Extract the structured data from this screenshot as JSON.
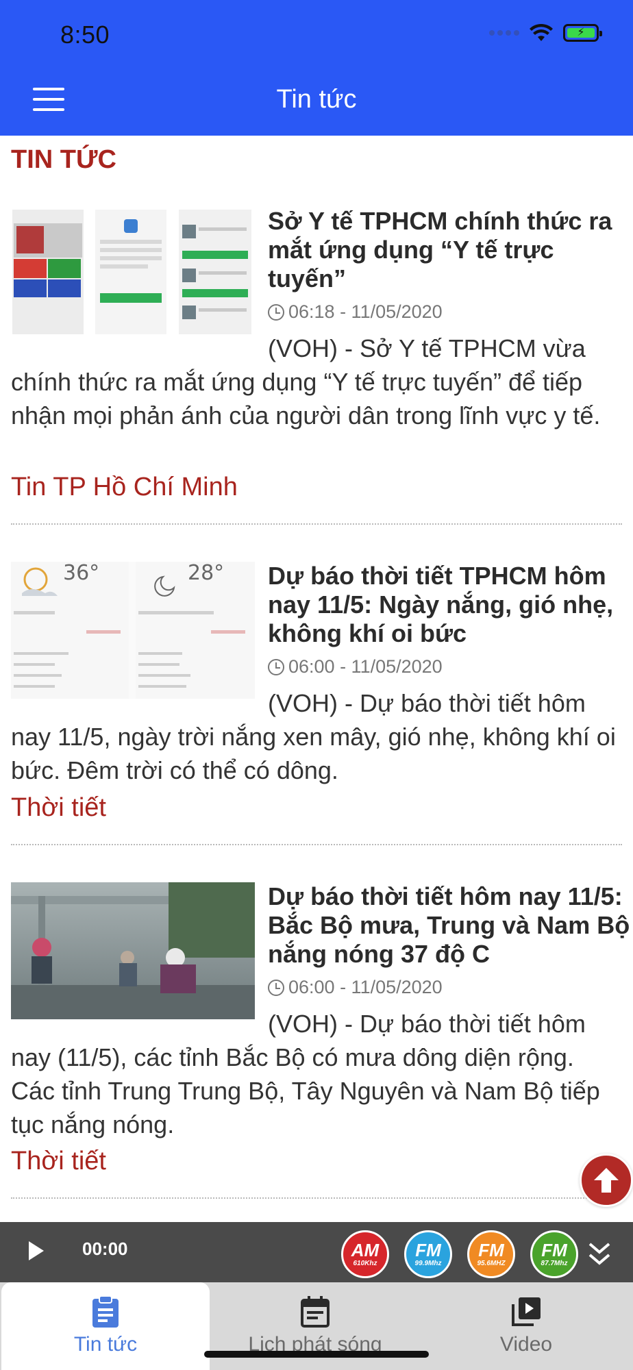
{
  "status_bar": {
    "time": "8:50"
  },
  "header": {
    "title": "Tin tức"
  },
  "section": {
    "title": "TIN TỨC"
  },
  "articles": [
    {
      "title": "Sở Y tế TPHCM chính thức ra mắt ứng dụng “Y tế trực tuyến”",
      "datetime": "06:18 - 11/05/2020",
      "summary": "(VOH) - Sở Y tế TPHCM vừa chính thức ra mắt ứng dụng “Y tế trực tuyến” để tiếp nhận mọi phản ánh của người dân trong lĩnh vực y tế.",
      "category": "Tin TP Hồ Chí Minh"
    },
    {
      "title": "Dự báo thời tiết TPHCM hôm nay 11/5: Ngày nắng, gió nhẹ, không khí oi bức",
      "datetime": "06:00 - 11/05/2020",
      "summary": "(VOH) - Dự báo thời tiết hôm nay 11/5, ngày trời nắng xen mây, gió nhẹ, không khí oi bức. Đêm trời có thể có dông.",
      "category": "Thời tiết",
      "thumb_temps": [
        "36°",
        "28°"
      ]
    },
    {
      "title": "Dự báo thời tiết hôm nay 11/5: Bắc Bộ mưa, Trung và Nam Bộ nắng nóng 37 độ C",
      "datetime": "06:00 - 11/05/2020",
      "summary": "(VOH) - Dự báo thời tiết hôm nay (11/5), các tỉnh Bắc Bộ có mưa dông diện rộng. Các tỉnh Trung Trung Bộ, Tây Nguyên và Nam Bộ tiếp tục nắng nóng.",
      "category": "Thời tiết"
    }
  ],
  "player": {
    "time": "00:00",
    "stations": [
      {
        "band": "AM",
        "freq": "610Khz",
        "color": "#d6262b"
      },
      {
        "band": "FM",
        "freq": "99.9Mhz",
        "color": "#2aa3de"
      },
      {
        "band": "FM",
        "freq": "95.6MHZ",
        "color": "#f08a23"
      },
      {
        "band": "FM",
        "freq": "87.7Mhz",
        "color": "#4aa32b"
      }
    ]
  },
  "tabs": [
    {
      "label": "Tin tức",
      "icon": "clipboard-icon",
      "active": true
    },
    {
      "label": "Lịch phát sóng",
      "icon": "calendar-icon",
      "active": false
    },
    {
      "label": "Video",
      "icon": "video-library-icon",
      "active": false
    }
  ],
  "colors": {
    "header": "#2a58f5",
    "accent_red": "#a8241e",
    "tab_active": "#4a7bdc"
  }
}
